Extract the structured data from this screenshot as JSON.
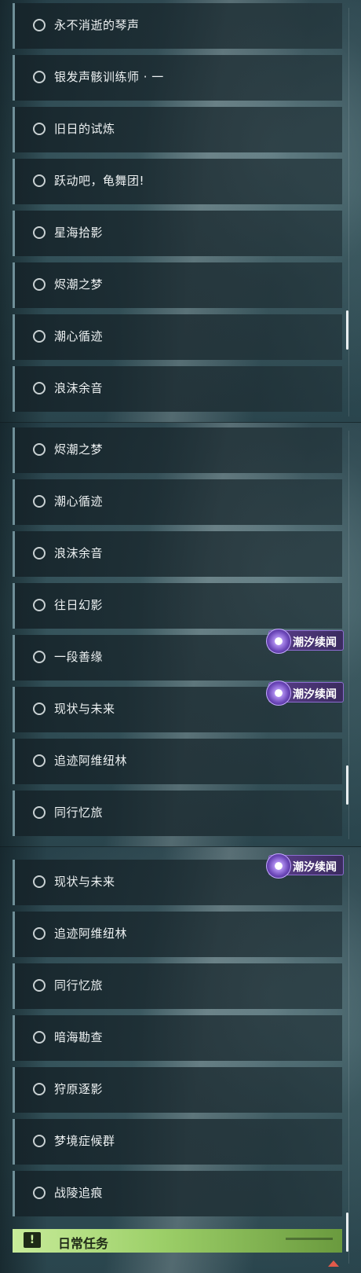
{
  "panel1": {
    "items": [
      {
        "label": "永不消逝的琴声"
      },
      {
        "label": "银发声骸训练师 · 一"
      },
      {
        "label": "旧日的试炼"
      },
      {
        "label": "跃动吧，龟舞团!"
      },
      {
        "label": "星海拾影"
      },
      {
        "label": "烬潮之梦"
      },
      {
        "label": "潮心循迹"
      },
      {
        "label": "浪沫余音"
      }
    ]
  },
  "panel2": {
    "items": [
      {
        "label": "烬潮之梦"
      },
      {
        "label": "潮心循迹"
      },
      {
        "label": "浪沫余音"
      },
      {
        "label": "往日幻影"
      },
      {
        "label": "一段善缘"
      },
      {
        "label": "现状与未来"
      },
      {
        "label": "追迹阿维纽林"
      },
      {
        "label": "同行忆旅"
      }
    ],
    "badges": [
      {
        "label": "潮汐续闻"
      },
      {
        "label": "潮汐续闻"
      }
    ]
  },
  "panel3": {
    "items": [
      {
        "label": "现状与未来"
      },
      {
        "label": "追迹阿维纽林"
      },
      {
        "label": "同行忆旅"
      },
      {
        "label": "暗海勘查"
      },
      {
        "label": "狩原逐影"
      },
      {
        "label": "梦境症候群"
      },
      {
        "label": "战陵追痕"
      }
    ],
    "badges": [
      {
        "label": "潮汐续闻"
      }
    ],
    "daily": {
      "icon": "exclamation-icon",
      "label": "日常任务"
    }
  },
  "icons": {
    "item": "circle-icon",
    "badge": "tide-emblem-icon",
    "bottom": "chevron-up-icon"
  },
  "colors": {
    "badge": "#5b3f8c",
    "daily": "#9ccf68",
    "text": "#eef2f3"
  }
}
